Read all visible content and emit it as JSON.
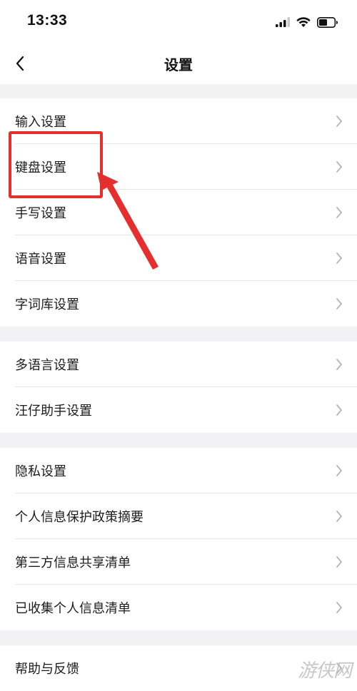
{
  "status_bar": {
    "time": "13:33",
    "icons": [
      "signal-icon",
      "wifi-icon",
      "battery-icon"
    ]
  },
  "nav": {
    "title": "设置",
    "back_icon": "chevron-left-icon"
  },
  "groups": [
    {
      "items": [
        {
          "label": "输入设置",
          "name": "input-settings"
        },
        {
          "label": "键盘设置",
          "name": "keyboard-settings"
        },
        {
          "label": "手写设置",
          "name": "handwriting-settings"
        },
        {
          "label": "语音设置",
          "name": "voice-settings"
        },
        {
          "label": "字词库设置",
          "name": "dictionary-settings"
        }
      ]
    },
    {
      "items": [
        {
          "label": "多语言设置",
          "name": "multilanguage-settings"
        },
        {
          "label": "汪仔助手设置",
          "name": "wangzai-assistant-settings"
        }
      ]
    },
    {
      "items": [
        {
          "label": "隐私设置",
          "name": "privacy-settings"
        },
        {
          "label": "个人信息保护政策摘要",
          "name": "privacy-policy-summary"
        },
        {
          "label": "第三方信息共享清单",
          "name": "third-party-sharing-list"
        },
        {
          "label": "已收集个人信息清单",
          "name": "collected-info-list"
        }
      ]
    },
    {
      "items": [
        {
          "label": "帮助与反馈",
          "name": "help-feedback"
        }
      ]
    }
  ],
  "annotation": {
    "color": "#e52f2f"
  },
  "watermark": {
    "text": "游侠网"
  },
  "colors": {
    "background": "#f2f2f4",
    "surface": "#ffffff",
    "chevron": "#b5b5b8"
  }
}
